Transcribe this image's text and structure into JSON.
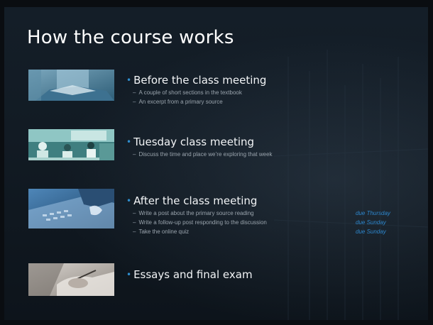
{
  "slide": {
    "title": "How the course works",
    "sections": [
      {
        "heading": "Before the class meeting",
        "image": "person-reading-book-image",
        "items": [
          {
            "text": "A couple of short sections in the textbook",
            "due": ""
          },
          {
            "text": "An excerpt from a primary source",
            "due": ""
          }
        ]
      },
      {
        "heading": "Tuesday class meeting",
        "image": "classroom-meeting-image",
        "items": [
          {
            "text": "Discuss the time and place we’re exploring that week",
            "due": ""
          }
        ]
      },
      {
        "heading": "After the class meeting",
        "image": "typing-on-laptop-image",
        "items": [
          {
            "text": "Write a post about the primary source reading",
            "due": "due Thursday"
          },
          {
            "text": "Write a follow-up post responding to the discussion",
            "due": "due Sunday"
          },
          {
            "text": "Take the online quiz",
            "due": "due Sunday"
          }
        ]
      },
      {
        "heading": "Essays and final exam",
        "image": "writing-on-paper-image",
        "items": []
      }
    ],
    "bullet_symbol": "•",
    "dash_symbol": "–"
  },
  "colors": {
    "background": "#121b24",
    "title": "#ffffff",
    "heading": "#f2f4f6",
    "subtext": "#9aa4ad",
    "accent": "#2f8fd0",
    "due": "#2d86cc"
  }
}
